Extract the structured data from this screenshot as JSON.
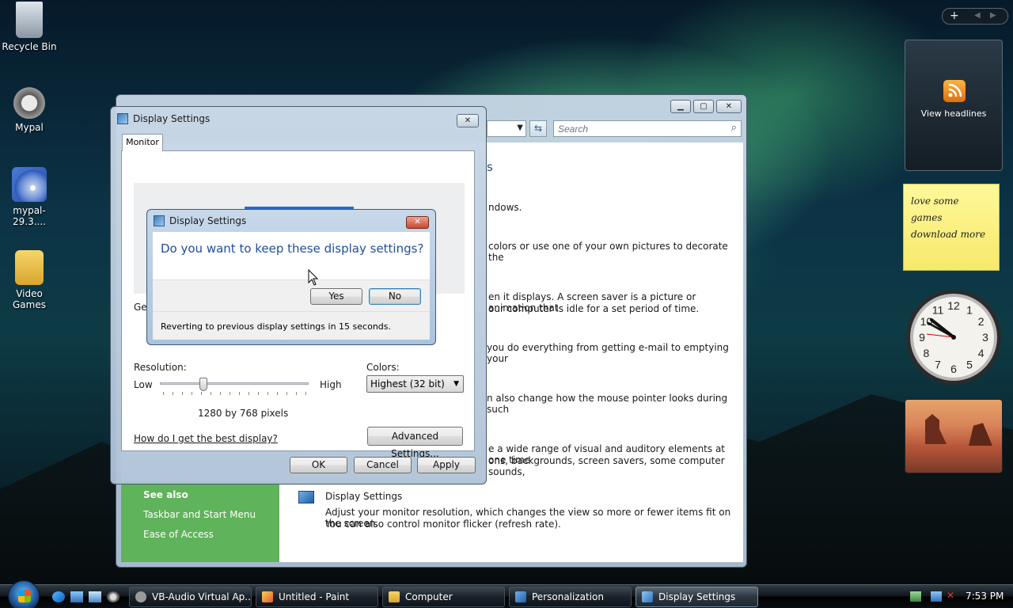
{
  "desktop": {
    "icons": [
      {
        "label": "Recycle Bin",
        "icon": "recycle-bin-icon"
      },
      {
        "label": "Mypal",
        "icon": "raccoon-icon"
      },
      {
        "label": "mypal-29.3....",
        "icon": "installer-cd-icon"
      },
      {
        "label": "Video Games",
        "icon": "folder-icon"
      }
    ]
  },
  "gadgets": {
    "feed_label": "View headlines",
    "note_lines": [
      "love some",
      "games",
      "download more"
    ],
    "clock_numbers": [
      "12",
      "1",
      "2",
      "3",
      "4",
      "5",
      "6",
      "7",
      "8",
      "9",
      "10",
      "11"
    ]
  },
  "personalization": {
    "search_placeholder": "Search",
    "heading_fragment": "s",
    "lines": [
      "ndows.",
      "colors or use one of your own pictures to decorate the",
      "en it displays. A screen saver is a picture or animation that",
      "our computer is idle for a set period of time.",
      "you do everything from getting e-mail to emptying your",
      "n also change how the mouse pointer looks during such",
      "e a wide range of visual and auditory elements at one time",
      "ons, backgrounds, screen savers, some computer sounds,"
    ],
    "see_also": "See also",
    "see_also_links": [
      "Taskbar and Start Menu",
      "Ease of Access"
    ],
    "display_settings_link": "Display Settings",
    "display_settings_desc1": "Adjust your monitor resolution, which changes the view so more or fewer items fit on the screen.",
    "display_settings_desc2": "You can also control monitor flicker (refresh rate)."
  },
  "display_settings": {
    "title": "Display Settings",
    "tab_monitor": "Monitor",
    "general_fragment": "Gen",
    "resolution_label": "Resolution:",
    "low": "Low",
    "high": "High",
    "resolution_value": "1280 by 768 pixels",
    "resolution_position": 0.28,
    "colors_label": "Colors:",
    "colors_value": "Highest (32 bit)",
    "help_link": "How do I get the best display?",
    "advanced_button": "Advanced Settings...",
    "ok": "OK",
    "cancel": "Cancel",
    "apply": "Apply"
  },
  "confirm_dialog": {
    "title": "Display Settings",
    "question": "Do you want to keep these display settings?",
    "yes": "Yes",
    "no": "No",
    "footer": "Reverting to previous display settings in 15 seconds."
  },
  "taskbar": {
    "buttons": [
      {
        "label": "VB-Audio Virtual Ap...",
        "active": false
      },
      {
        "label": "Untitled - Paint",
        "active": false
      },
      {
        "label": "Computer",
        "active": false
      },
      {
        "label": "Personalization",
        "active": false
      },
      {
        "label": "Display Settings",
        "active": true
      }
    ],
    "clock": "7:53 PM"
  },
  "colors": {
    "sidebar_green": "#5fb35a",
    "link_blue": "#0a52a8",
    "dialog_blue_text": "#1f4e9c"
  }
}
